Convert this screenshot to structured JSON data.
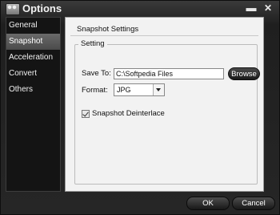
{
  "window": {
    "title": "Options",
    "minimize_glyph": "▬",
    "close_glyph": "✕"
  },
  "sidebar": {
    "items": [
      {
        "label": "General",
        "active": false
      },
      {
        "label": "Snapshot",
        "active": true
      },
      {
        "label": "Acceleration",
        "active": false
      },
      {
        "label": "Convert",
        "active": false
      },
      {
        "label": "Others",
        "active": false
      }
    ]
  },
  "content": {
    "title": "Snapshot Settings",
    "group_title": "Setting",
    "save_to_label": "Save To:",
    "save_to_value": "C:\\Softpedia Files",
    "browse_label": "Browse",
    "format_label": "Format:",
    "format_value": "JPG",
    "deinterlace_label": "Snapshot Deinterlace",
    "deinterlace_checked": true
  },
  "buttons": {
    "ok_label": "OK",
    "cancel_label": "Cancel"
  },
  "colors": {
    "frame": "#262626",
    "panel": "#f2f2f2",
    "sidebar_bg": "#141414",
    "active_item": "#5a5a5a"
  }
}
